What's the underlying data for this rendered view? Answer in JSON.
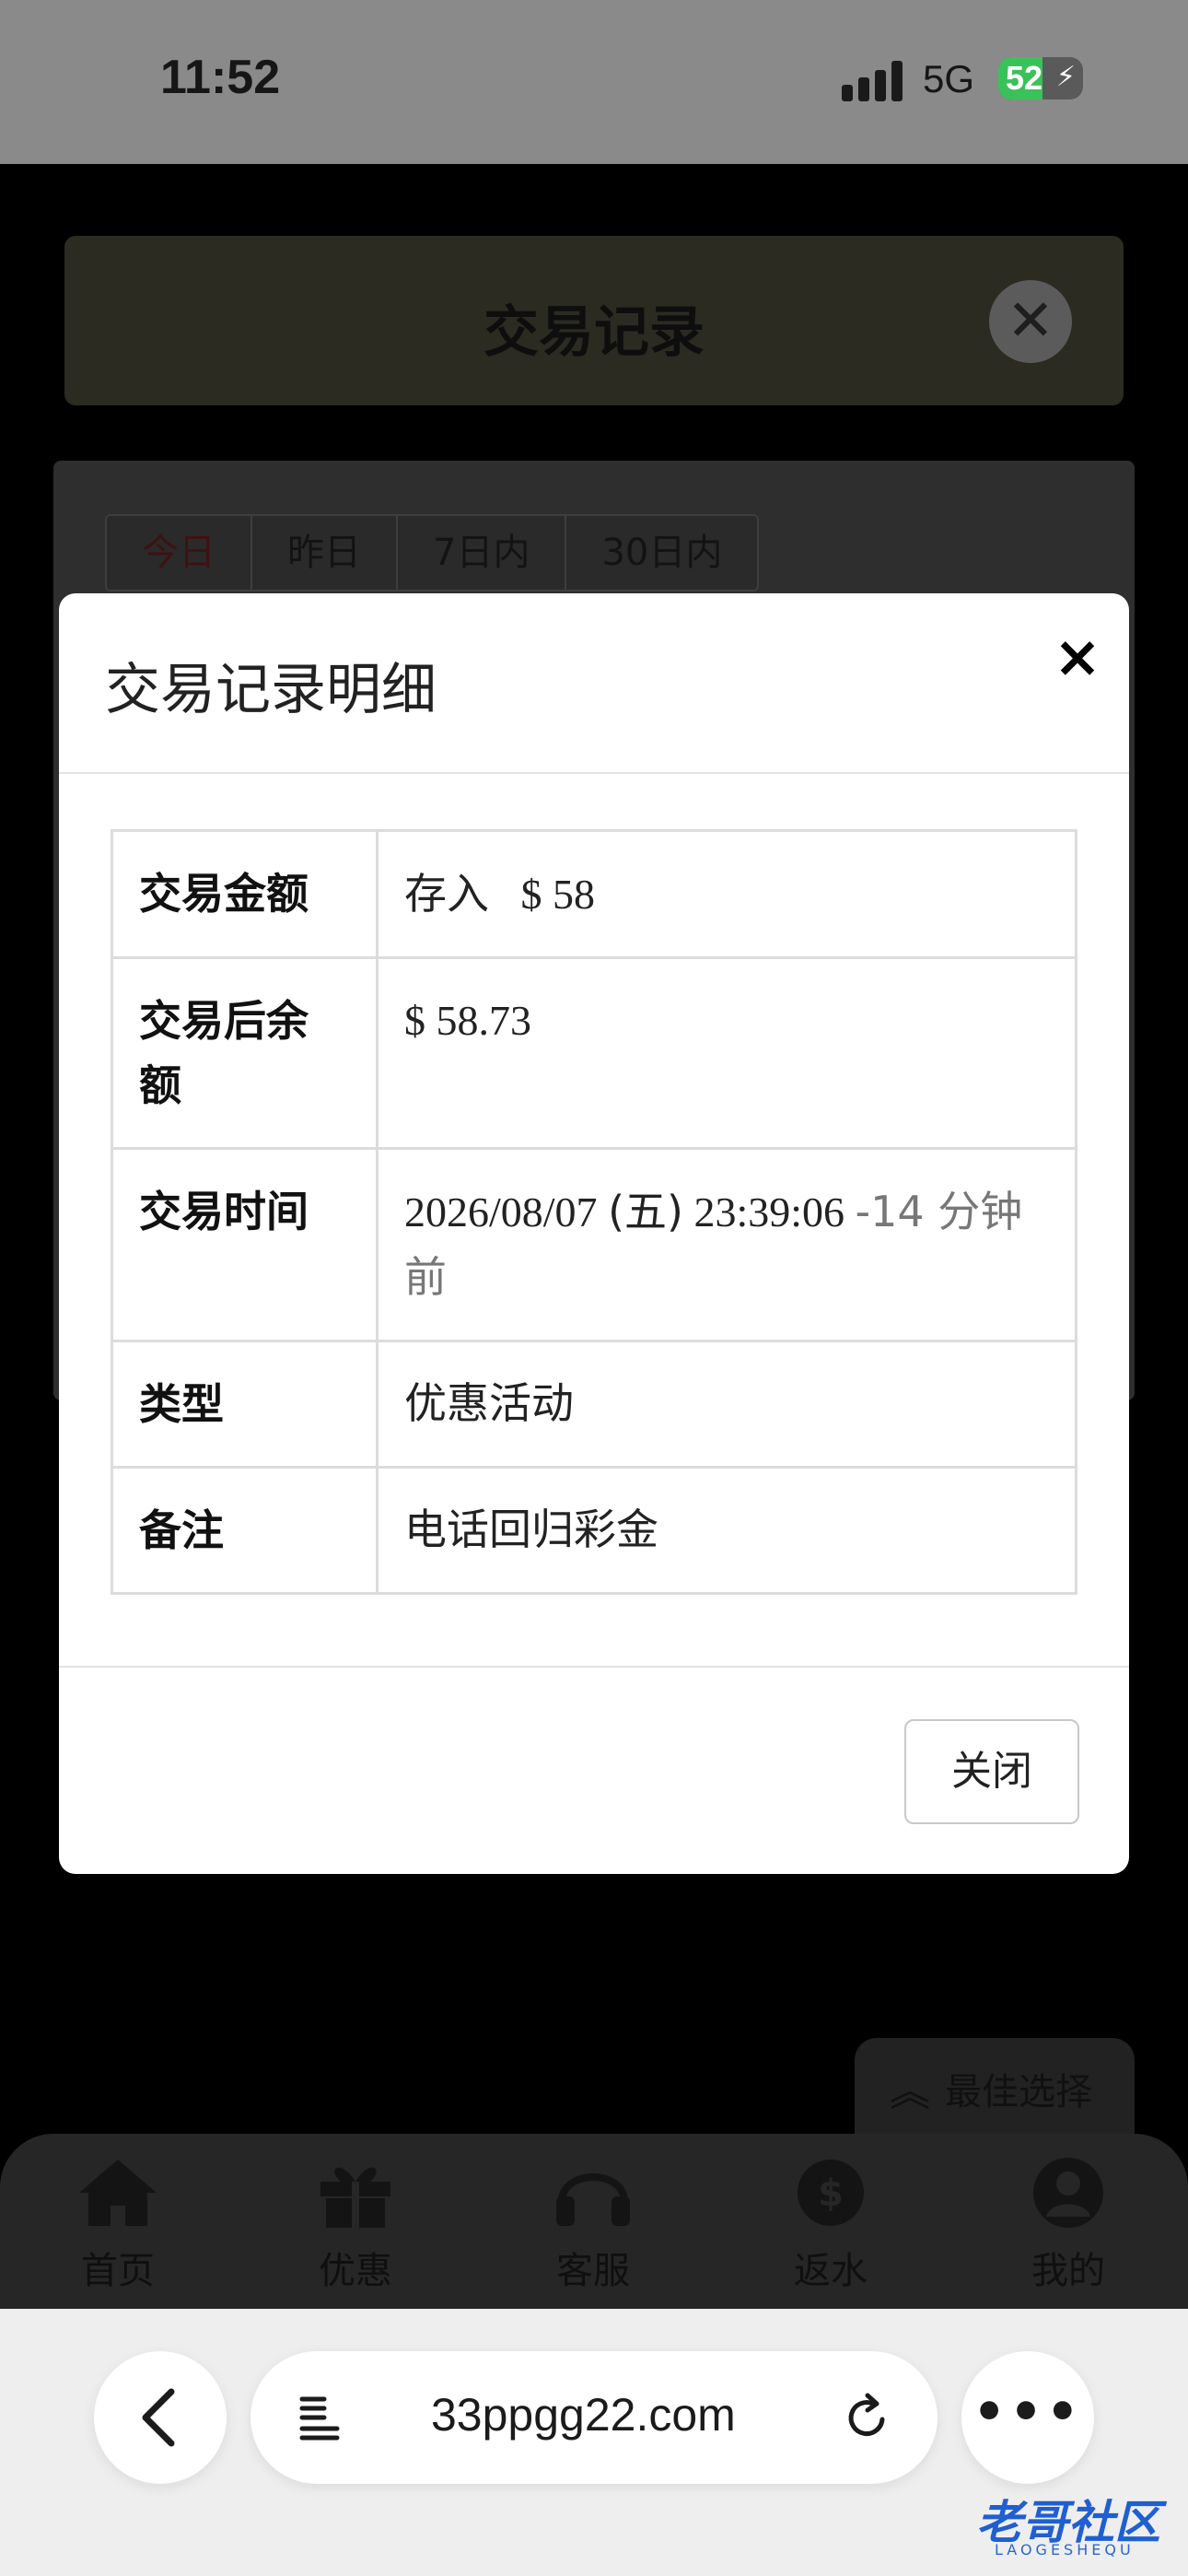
{
  "status_bar": {
    "time": "11:52",
    "network": "5G",
    "battery": "52",
    "battery_level": 0.52
  },
  "background": {
    "header_title": "交易记录",
    "tabs": [
      {
        "label": "今日",
        "active": true
      },
      {
        "label": "昨日",
        "active": false
      },
      {
        "label": "7日内",
        "active": false
      },
      {
        "label": "30日内",
        "active": false
      }
    ],
    "best_choice": "最佳选择",
    "nav": [
      {
        "label": "首页",
        "icon": "home-icon"
      },
      {
        "label": "优惠",
        "icon": "gift-icon"
      },
      {
        "label": "客服",
        "icon": "headset-icon"
      },
      {
        "label": "返水",
        "icon": "dollar-badge-icon"
      },
      {
        "label": "我的",
        "icon": "user-icon"
      }
    ]
  },
  "modal": {
    "title": "交易记录明细",
    "rows": {
      "amount": {
        "label": "交易金额",
        "type": "存入",
        "value": "$ 58"
      },
      "balance": {
        "label": "交易后余额",
        "value": "$ 58.73"
      },
      "time": {
        "label": "交易时间",
        "value": "2026/08/07",
        "weekday": "(五)",
        "clock": "23:39:06",
        "relative": "-14 分钟前"
      },
      "category": {
        "label": "类型",
        "value": "优惠活动"
      },
      "note": {
        "label": "备注",
        "value": "电话回归彩金"
      }
    },
    "close_label": "关闭"
  },
  "browser": {
    "url": "33ppgg22.com"
  },
  "watermark": {
    "text": "老哥社区",
    "sub": "LAOGESHEQU"
  },
  "colors": {
    "deposit_green": "#3f8a3f",
    "battery_green": "#3ac25a",
    "watermark_blue": "#1f5fd0"
  }
}
